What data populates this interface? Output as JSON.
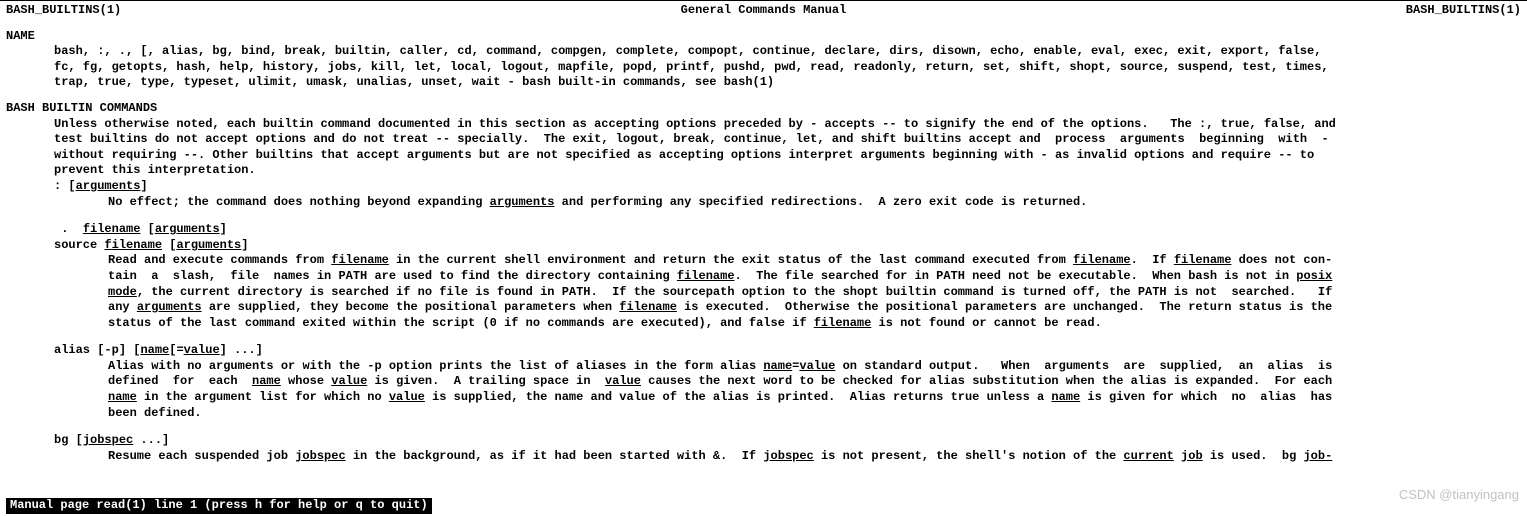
{
  "header": {
    "left": "BASH_BUILTINS(1)",
    "center": "General Commands Manual",
    "right": "BASH_BUILTINS(1)"
  },
  "name": {
    "title": "NAME",
    "l1": "bash,  :, ., [, alias, bg, bind, break, builtin, caller, cd, command, compgen, complete, compopt, continue, declare, dirs, disown, echo, enable, eval, exec, exit, export, false,",
    "l2": "fc, fg, getopts, hash, help, history, jobs, kill, let, local, logout, mapfile, popd, printf, pushd, pwd, read, readonly, return, set, shift, shopt, source, suspend, test, times,",
    "l3a": "trap, true, type, typeset, ulimit, umask, unalias, unset, wait - bash built-in commands, see ",
    "l3b": "bash",
    "l3c": "(1)"
  },
  "bb": {
    "title": "BASH BUILTIN COMMANDS",
    "p1": {
      "a": "Unless otherwise noted, each builtin command documented in this section as accepting options preceded by ",
      "b": "-",
      "c": " accepts ",
      "d": "--",
      "e": " to signify the end of the options.   The ",
      "f": ":",
      "g": ", ",
      "h": "true",
      "i": ", ",
      "j": "false",
      "k": ", and"
    },
    "p2": {
      "a": "test",
      "b": " builtins do not accept options and do not treat -- specially.  The ",
      "c": "exit",
      "d": ", ",
      "e": "logout",
      "f": ", ",
      "g": "break",
      "h": ", ",
      "i": "continue",
      "j": ", ",
      "k": "let",
      "l": ", and ",
      "m": "shift",
      "n": " builtins accept and  process  arguments  beginning  with  -"
    },
    "p3": "without  requiring --.  Other builtins that accept arguments but are not specified as accepting options interpret arguments beginning with - as invalid options and require -- to",
    "p4": "prevent this interpretation.",
    "colon": {
      "a": ": [",
      "b": "arguments",
      "c": "]"
    },
    "colon_desc": {
      "a": "No effect; the command does nothing beyond expanding ",
      "b": "arguments",
      "c": " and performing any specified redirections.  A zero exit code is returned."
    },
    "dot": {
      "a": " .  ",
      "b": "filename",
      "c": " [",
      "d": "arguments",
      "e": "]"
    },
    "src": {
      "a": "source ",
      "b": "filename",
      "c": " [",
      "d": "arguments",
      "e": "]"
    },
    "s1": {
      "a": "Read and execute commands from ",
      "b": "filename",
      "c": " in the current shell environment and return the exit status of the last command executed from ",
      "d": "filename",
      "e": ".  If ",
      "f": "filename",
      "g": " does not con-"
    },
    "s2": {
      "a": "tain  a  slash,  file  names in ",
      "b": "PATH",
      "c": " are used to find the directory containing ",
      "d": "filename",
      "e": ".  The file searched for in ",
      "f": "PATH",
      "g": " need not be executable.  When ",
      "h": "bash",
      "i": " is not in ",
      "j": "posix"
    },
    "s3": {
      "a": "mode",
      "b": ", the current directory is searched if no file is found in ",
      "c": "PATH",
      "d": ".  If the ",
      "e": "sourcepath",
      "f": " option to the ",
      "g": "shopt",
      "h": " builtin command is turned off, the ",
      "i": "PATH",
      "j": " is not  searched.   If"
    },
    "s4": {
      "a": "any ",
      "b": "arguments",
      "c": " are supplied, they become the positional parameters when ",
      "d": "filename",
      "e": " is executed.  Otherwise the positional parameters are unchanged.  The return status is the"
    },
    "s5": {
      "a": "status of the last command exited within the script (0 if no commands are executed), and false if ",
      "b": "filename",
      "c": " is not found or cannot be read."
    },
    "alias_syn": {
      "a": "alias ",
      "b": "[",
      "c": "-p",
      "d": "] [",
      "e": "name",
      "f": "[=",
      "g": "value",
      "h": "] ...]"
    },
    "a1": {
      "a": "Alias",
      "b": " with no arguments or with the ",
      "c": "-p",
      "d": " option prints the list of aliases in the form ",
      "e": "alias",
      "f": " ",
      "g": "name",
      "h": "=",
      "i": "value",
      "j": " on standard output.   When  arguments  are  supplied,  an  alias  is"
    },
    "a2": {
      "a": "defined  for  each  ",
      "b": "name",
      "c": " whose ",
      "d": "value",
      "e": " is given.  A trailing space in  ",
      "f": "value",
      "g": " causes the next word to be checked for alias substitution when the alias is expanded.  For each"
    },
    "a3": {
      "a": "name",
      "b": " in the argument list for which no ",
      "c": "value",
      "d": " is supplied, the name and value of the alias is printed.  ",
      "e": "Alias",
      "f": " returns true unless a ",
      "g": "name",
      "h": " is given for which  no  alias  has"
    },
    "a4": "been defined.",
    "bg_syn": {
      "a": "bg ",
      "b": "[",
      "c": "jobspec",
      "d": " ...]"
    },
    "b1": {
      "a": "Resume each suspended job ",
      "b": "jobspec",
      "c": " in the background, as if it had been started with ",
      "d": "&",
      "e": ".  If ",
      "f": "jobspec",
      "g": " is not present, the shell's notion of the ",
      "h": "current",
      "i": " ",
      "j": "job",
      "k": " is used.  ",
      "l": "bg",
      "m": " ",
      "n": "job-"
    }
  },
  "status": "Manual page read(1) line 1 (press h for help or q to quit)",
  "watermark": "CSDN @tianyingang"
}
